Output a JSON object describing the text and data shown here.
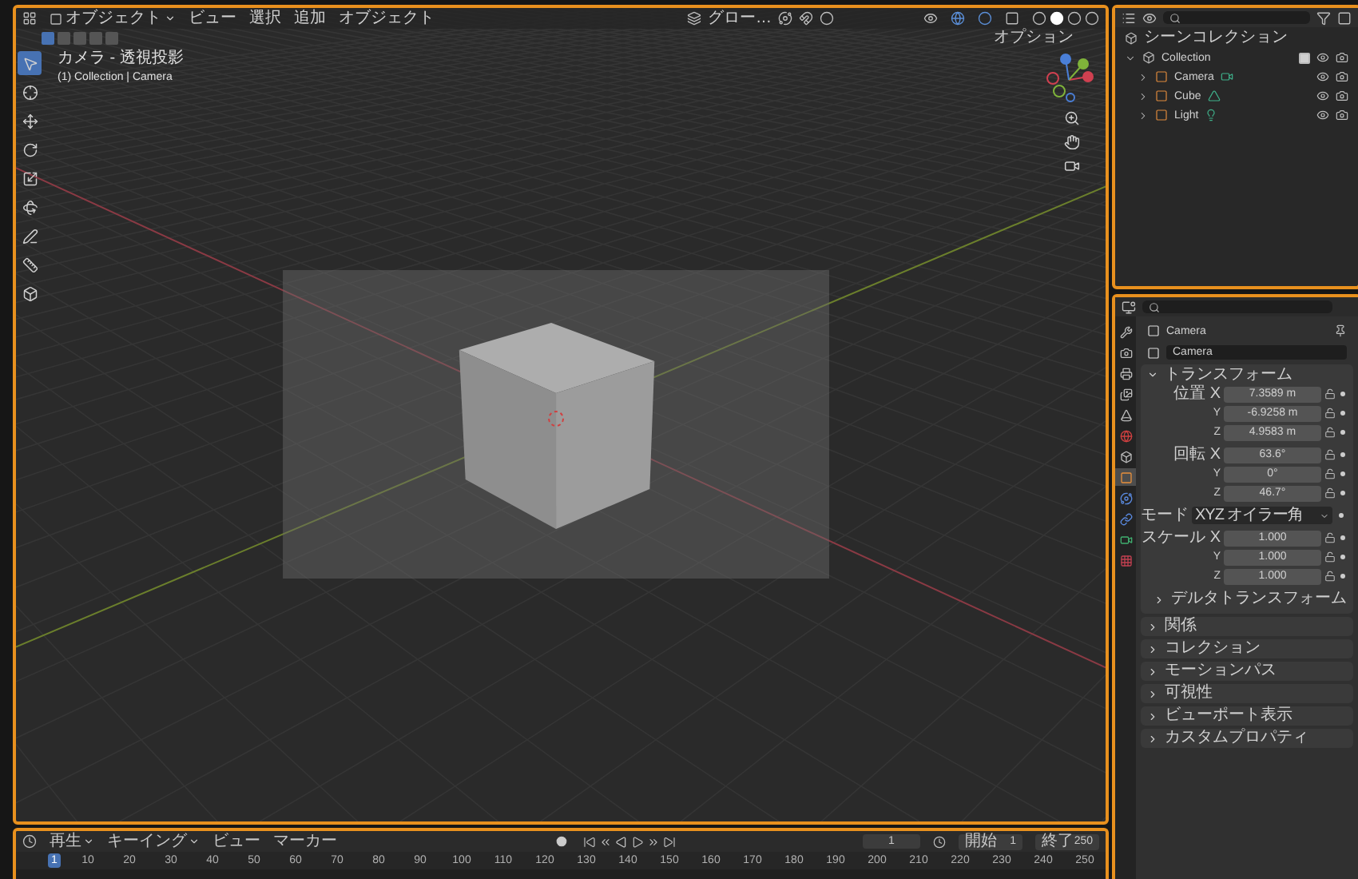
{
  "viewport": {
    "mode": "オブジェクト",
    "menus": [
      "ビュー",
      "選択",
      "追加",
      "オブジェクト"
    ],
    "pivot": "グロー…",
    "options": "オプション",
    "overlay_title": "カメラ - 透視投影",
    "overlay_subtitle": "(1) Collection | Camera",
    "select_modes": [
      {
        "selected": true
      },
      {
        "selected": false
      },
      {
        "selected": false
      },
      {
        "selected": false
      },
      {
        "selected": false
      }
    ],
    "tools": [
      {
        "kind": "select",
        "selected": true
      },
      {
        "kind": "cursor",
        "selected": false
      },
      {
        "kind": "move",
        "selected": false
      },
      {
        "kind": "rotate",
        "selected": false
      },
      {
        "kind": "scale",
        "selected": false
      },
      {
        "kind": "transform",
        "selected": false
      },
      {
        "kind": "annotate",
        "selected": false
      },
      {
        "kind": "measure",
        "selected": false
      },
      {
        "kind": "add_cube",
        "selected": false
      }
    ]
  },
  "outliner": {
    "root": "シーンコレクション",
    "collection": {
      "label": "Collection",
      "expanded": true,
      "checked": true,
      "children": [
        {
          "label": "Camera",
          "kind": "camera",
          "expanded": false
        },
        {
          "label": "Cube",
          "kind": "mesh",
          "expanded": false
        },
        {
          "label": "Light",
          "kind": "light",
          "expanded": false
        }
      ]
    }
  },
  "properties": {
    "tabs": [
      {
        "kind": "tool",
        "selected": false
      },
      {
        "kind": "render",
        "selected": false
      },
      {
        "kind": "output",
        "selected": false
      },
      {
        "kind": "view_layer",
        "selected": false
      },
      {
        "kind": "scene",
        "selected": false
      },
      {
        "kind": "world",
        "selected": false
      },
      {
        "kind": "collection",
        "selected": false
      },
      {
        "kind": "object",
        "selected": true
      },
      {
        "kind": "physics",
        "selected": false
      },
      {
        "kind": "constraints",
        "selected": false
      },
      {
        "kind": "data",
        "selected": false
      },
      {
        "kind": "texture",
        "selected": false
      }
    ],
    "object_name": "Camera",
    "name_field": "Camera",
    "transform": {
      "title": "トランスフォーム",
      "expanded": true,
      "groups": [
        {
          "rows": [
            {
              "kind": "number",
              "label": "位置 X",
              "value": "7.3589 m"
            },
            {
              "kind": "number",
              "label": "Y",
              "value": "-6.9258 m"
            },
            {
              "kind": "number",
              "label": "Z",
              "value": "4.9583 m"
            }
          ]
        },
        {
          "rows": [
            {
              "kind": "number",
              "label": "回転 X",
              "value": "63.6°"
            },
            {
              "kind": "number",
              "label": "Y",
              "value": "0°"
            },
            {
              "kind": "number",
              "label": "Z",
              "value": "46.7°"
            }
          ]
        },
        {
          "rows": [
            {
              "kind": "dropdown",
              "label": "モード",
              "value": "XYZ オイラー角"
            }
          ]
        },
        {
          "rows": [
            {
              "kind": "number",
              "label": "スケール X",
              "value": "1.000"
            },
            {
              "kind": "number",
              "label": "Y",
              "value": "1.000"
            },
            {
              "kind": "number",
              "label": "Z",
              "value": "1.000"
            }
          ]
        }
      ],
      "subpanel": {
        "title": "デルタトランスフォーム",
        "expanded": false
      }
    },
    "panels": [
      {
        "title": "関係",
        "expanded": false
      },
      {
        "title": "コレクション",
        "expanded": false
      },
      {
        "title": "モーションパス",
        "expanded": false
      },
      {
        "title": "可視性",
        "expanded": false
      },
      {
        "title": "ビューポート表示",
        "expanded": false
      },
      {
        "title": "カスタムプロパティ",
        "expanded": false
      }
    ]
  },
  "timeline": {
    "menus": [
      {
        "label": "再生",
        "dropdown": true
      },
      {
        "label": "キーイング",
        "dropdown": true
      },
      {
        "label": "ビュー",
        "dropdown": false
      },
      {
        "label": "マーカー",
        "dropdown": false
      }
    ],
    "current_frame": "1",
    "start_label": "開始",
    "start": "1",
    "end_label": "終了",
    "end": "250",
    "ruler": [
      {
        "label": "1",
        "selected": true
      },
      {
        "label": "10",
        "selected": false
      },
      {
        "label": "20",
        "selected": false
      },
      {
        "label": "30",
        "selected": false
      },
      {
        "label": "40",
        "selected": false
      },
      {
        "label": "50",
        "selected": false
      },
      {
        "label": "60",
        "selected": false
      },
      {
        "label": "70",
        "selected": false
      },
      {
        "label": "80",
        "selected": false
      },
      {
        "label": "90",
        "selected": false
      },
      {
        "label": "100",
        "selected": false
      },
      {
        "label": "110",
        "selected": false
      },
      {
        "label": "120",
        "selected": false
      },
      {
        "label": "130",
        "selected": false
      },
      {
        "label": "140",
        "selected": false
      },
      {
        "label": "150",
        "selected": false
      },
      {
        "label": "160",
        "selected": false
      },
      {
        "label": "170",
        "selected": false
      },
      {
        "label": "180",
        "selected": false
      },
      {
        "label": "190",
        "selected": false
      },
      {
        "label": "200",
        "selected": false
      },
      {
        "label": "210",
        "selected": false
      },
      {
        "label": "220",
        "selected": false
      },
      {
        "label": "230",
        "selected": false
      },
      {
        "label": "240",
        "selected": false
      },
      {
        "label": "250",
        "selected": false
      }
    ]
  }
}
